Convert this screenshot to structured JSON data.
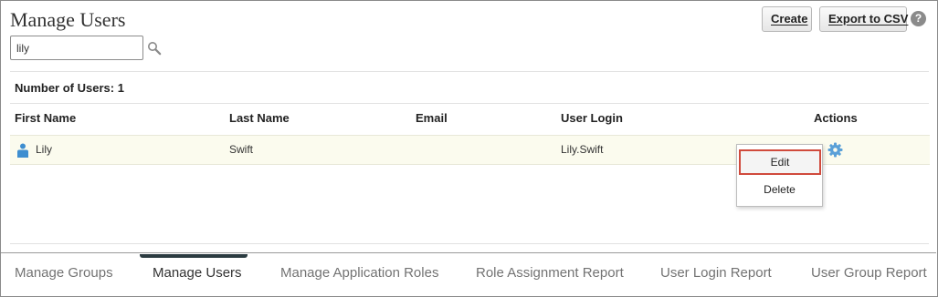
{
  "page": {
    "title": "Manage Users",
    "create_label": "Create",
    "export_label": "Export to CSV",
    "help_glyph": "?"
  },
  "search": {
    "value": "lily",
    "placeholder": ""
  },
  "summary": {
    "count_label": "Number of Users: 1"
  },
  "table": {
    "columns": [
      "First Name",
      "Last Name",
      "Email",
      "User Login",
      "Actions"
    ],
    "rows": [
      {
        "first_name": "Lily",
        "last_name": "Swift",
        "email": "",
        "user_login": "Lily.Swift"
      }
    ]
  },
  "actions_menu": {
    "items": [
      "Edit",
      "Delete"
    ],
    "highlighted": "Edit"
  },
  "tabs": [
    {
      "label": "Manage Groups",
      "active": false
    },
    {
      "label": "Manage Users",
      "active": true
    },
    {
      "label": "Manage Application Roles",
      "active": false
    },
    {
      "label": "Role Assignment Report",
      "active": false
    },
    {
      "label": "User Login Report",
      "active": false
    },
    {
      "label": "User Group Report",
      "active": false
    }
  ],
  "icons": {
    "search": "search-icon",
    "user": "user-icon",
    "actions": "gear-icon",
    "help": "help-icon"
  },
  "colors": {
    "accent": "#3e8ed0",
    "highlight_border": "#d04a3c",
    "row_highlight": "#fbfbee",
    "active_tab_indicator": "#2b3b40"
  }
}
